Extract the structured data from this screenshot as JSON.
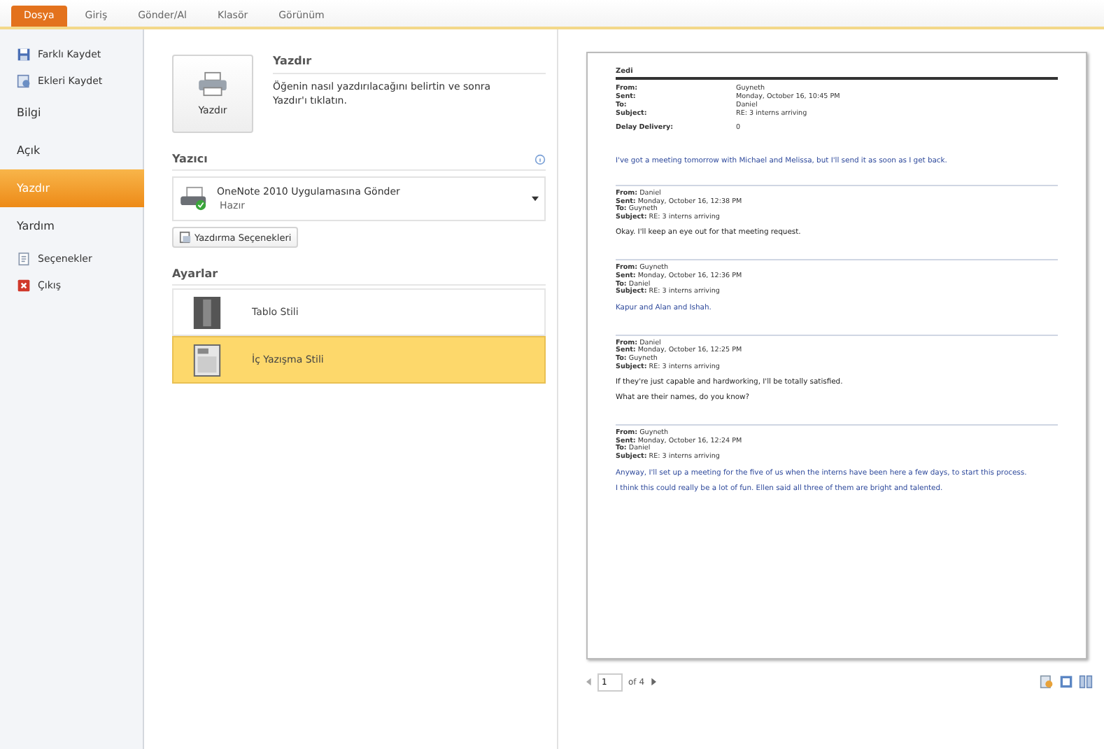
{
  "tabs": [
    {
      "label": "Dosya",
      "selected": true
    },
    {
      "label": "Giriş",
      "selected": false
    },
    {
      "label": "Gönder/Al",
      "selected": false
    },
    {
      "label": "Klasör",
      "selected": false
    },
    {
      "label": "Görünüm",
      "selected": false
    }
  ],
  "nav": [
    {
      "label": "Farklı Kaydet",
      "kind": "save",
      "selected": false
    },
    {
      "label": "Ekleri Kaydet",
      "kind": "attach",
      "selected": false
    },
    {
      "label": "Bilgi",
      "kind": "page",
      "selected": false
    },
    {
      "label": "Açık",
      "kind": "page",
      "selected": false
    },
    {
      "label": "Yazdır",
      "kind": "page",
      "selected": true
    },
    {
      "label": "Yardım",
      "kind": "page",
      "selected": false
    },
    {
      "label": "Seçenekler",
      "kind": "options",
      "selected": false
    },
    {
      "label": "Çıkış",
      "kind": "exit",
      "selected": false
    }
  ],
  "print": {
    "button": "Yazdır",
    "title": "Yazdır",
    "description": "Öğenin nasıl yazdırılacağını belirtin ve sonra Yazdır'ı tıklatın."
  },
  "printer": {
    "heading": "Yazıcı",
    "name": "OneNote 2010 Uygulamasına Gönder",
    "status": "Hazır",
    "properties": "Yazdırma Seçenekleri"
  },
  "settings": {
    "heading": "Ayarlar",
    "options": [
      {
        "label": "Tablo Stili",
        "kind": "table",
        "selected": false
      },
      {
        "label": "İç Yazışma Stili",
        "kind": "memo",
        "selected": true
      }
    ]
  },
  "preview": {
    "name": "Zedi",
    "fields": [
      {
        "label": "From:",
        "value": "Guyneth"
      },
      {
        "label": "Sent:",
        "value": "Monday, October 16, 10:45 PM"
      },
      {
        "label": "To:",
        "value": "Daniel"
      },
      {
        "label": "Subject:",
        "value": "RE: 3 interns arriving"
      }
    ],
    "extra": {
      "label": "Delay Delivery:",
      "value": "0"
    },
    "body": {
      "text": "I've got a meeting tomorrow with Michael and Melissa, but I'll send it as soon as I get back.",
      "color": "#2f4a9c"
    },
    "messages": [
      {
        "header": [
          {
            "label": "From:",
            "value": "Daniel"
          },
          {
            "label": "Sent:",
            "value": "Monday, October 16, 12:38 PM"
          },
          {
            "label": "To:",
            "value": "Guyneth"
          },
          {
            "label": "Subject:",
            "value": "RE: 3 interns arriving"
          }
        ],
        "paragraphs": [
          "Okay. I'll keep an eye out for that meeting request."
        ],
        "color": "#222222"
      },
      {
        "header": [
          {
            "label": "From:",
            "value": "Guyneth"
          },
          {
            "label": "Sent:",
            "value": "Monday, October 16, 12:36 PM"
          },
          {
            "label": "To:",
            "value": "Daniel"
          },
          {
            "label": "Subject:",
            "value": "RE: 3 interns arriving"
          }
        ],
        "paragraphs": [
          "Kapur and Alan and Ishah."
        ],
        "color": "#2f4a9c"
      },
      {
        "header": [
          {
            "label": "From:",
            "value": "Daniel"
          },
          {
            "label": "Sent:",
            "value": "Monday, October 16, 12:25 PM"
          },
          {
            "label": "To:",
            "value": "Guyneth"
          },
          {
            "label": "Subject:",
            "value": "RE: 3 interns arriving"
          }
        ],
        "paragraphs": [
          "If they're just capable and hardworking, I'll be totally satisfied.",
          "What are their names, do you know?"
        ],
        "color": "#222222"
      },
      {
        "header": [
          {
            "label": "From:",
            "value": "Guyneth"
          },
          {
            "label": "Sent:",
            "value": "Monday, October 16, 12:24 PM"
          },
          {
            "label": "To:",
            "value": "Daniel"
          },
          {
            "label": "Subject:",
            "value": "RE: 3 interns arriving"
          }
        ],
        "paragraphs": [
          "Anyway, I'll set up a meeting for the five of us when the interns have been here a few days, to start this process.",
          "I think this could really be a lot of fun. Ellen said all three of them are bright and talented."
        ],
        "color": "#2f4a9c"
      }
    ]
  },
  "pager": {
    "page": "1",
    "total": "of 4"
  }
}
